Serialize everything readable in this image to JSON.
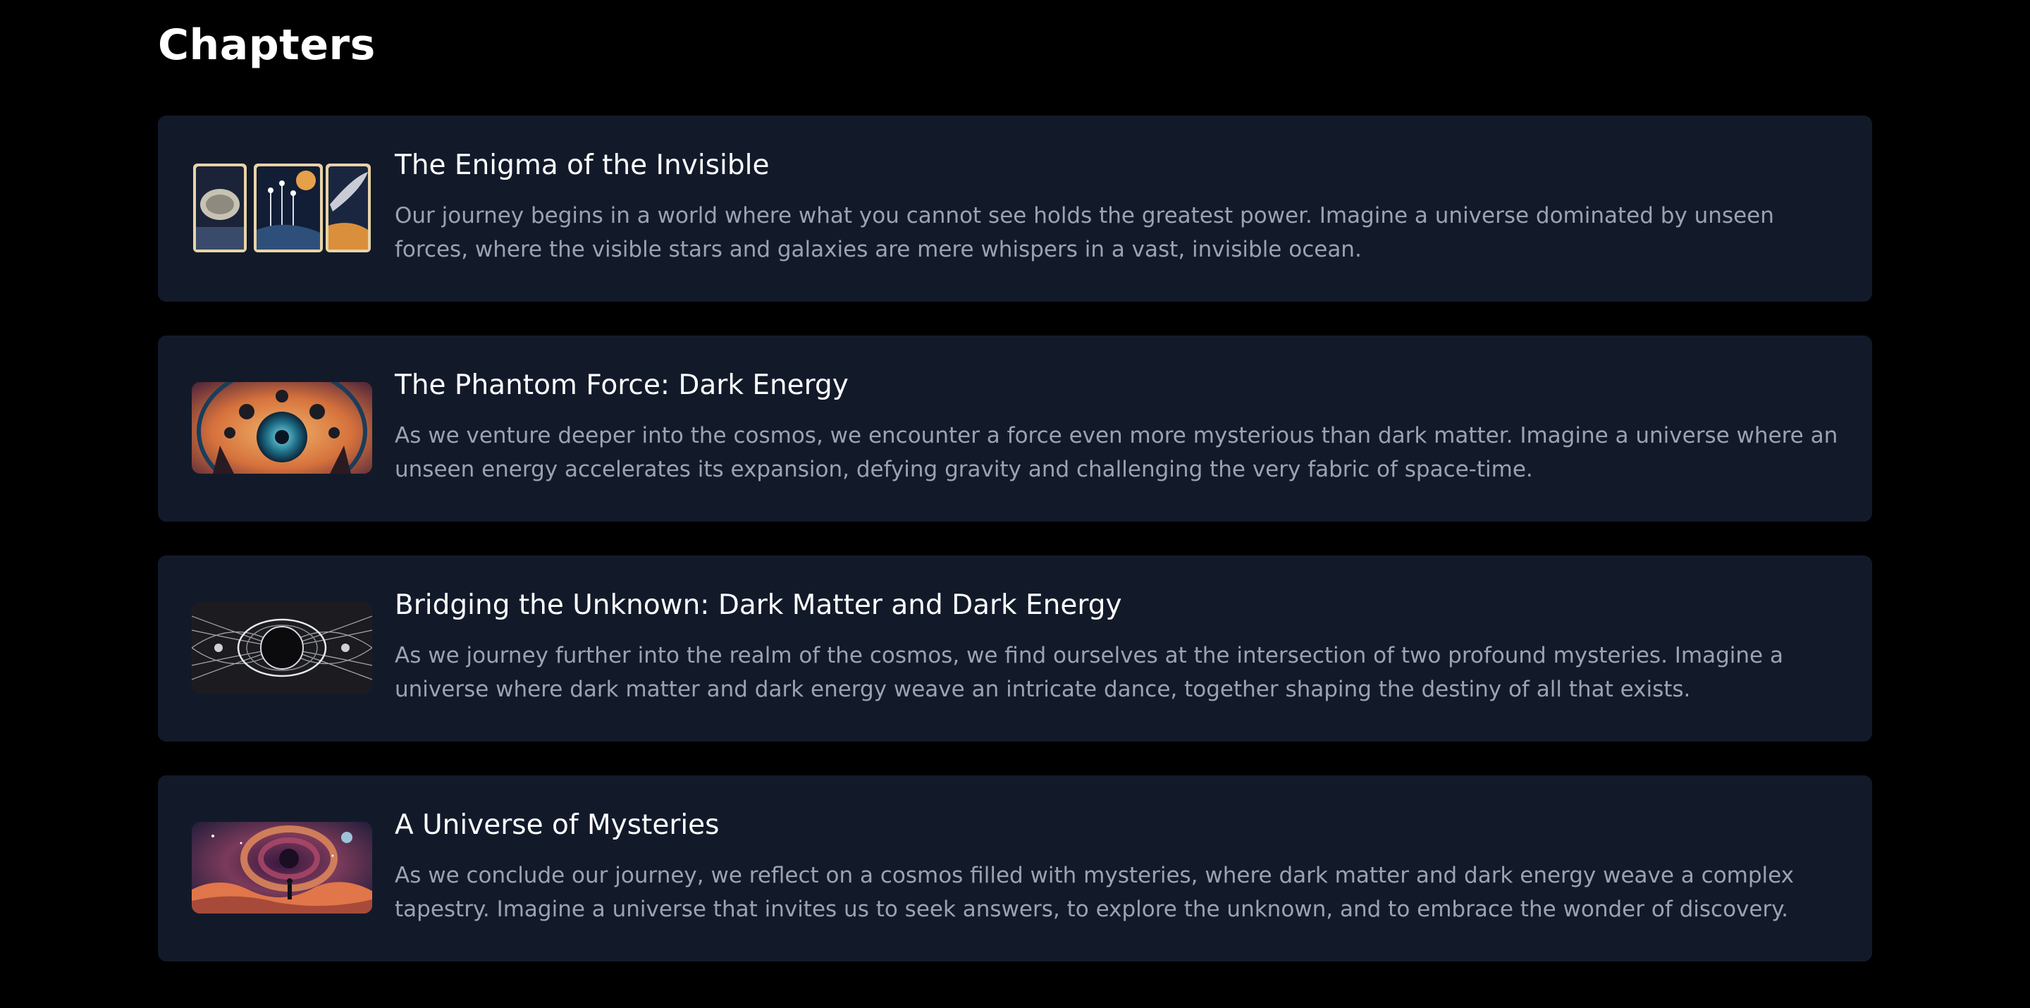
{
  "page": {
    "title": "Chapters"
  },
  "chapters": [
    {
      "title": "The Enigma of the Invisible",
      "description": "Our journey begins in a world where what you cannot see holds the greatest power. Imagine a universe dominated by unseen forces, where the visible stars and galaxies are mere whispers in a vast, invisible ocean.",
      "thumbnail": "three-tarot-cards-cosmic-image"
    },
    {
      "title": "The Phantom Force: Dark Energy",
      "description": "As we venture deeper into the cosmos, we encounter a force even more mysterious than dark matter. Imagine a universe where an unseen energy accelerates its expansion, defying gravity and challenging the very fabric of space-time.",
      "thumbnail": "cosmic-orb-portal-image"
    },
    {
      "title": "Bridging the Unknown: Dark Matter and Dark Energy",
      "description": "As we journey further into the realm of the cosmos, we find ourselves at the intersection of two profound mysteries. Imagine a universe where dark matter and dark energy weave an intricate dance, together shaping the destiny of all that exists.",
      "thumbnail": "black-hole-field-lines-image"
    },
    {
      "title": "A Universe of Mysteries",
      "description": "As we conclude our journey, we reflect on a cosmos filled with mysteries, where dark matter and dark energy weave a complex tapestry. Imagine a universe that invites us to seek answers, to explore the unknown, and to embrace the wonder of discovery.",
      "thumbnail": "figure-before-cosmic-swirl-image"
    }
  ],
  "colors": {
    "background": "#000000",
    "card": "#121a2a",
    "title_text": "#ffffff",
    "description_text": "#9aa3b2"
  }
}
